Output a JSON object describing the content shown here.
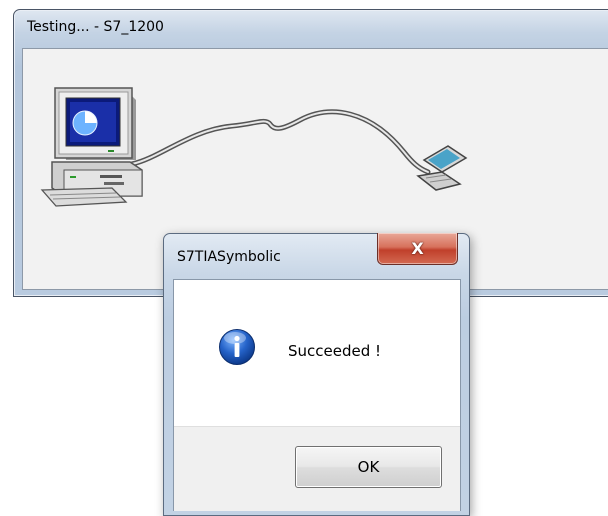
{
  "testing_window": {
    "title": "Testing... - S7_1200"
  },
  "dialog": {
    "title": "S7TIASymbolic",
    "close_glyph": "X",
    "message": "Succeeded !",
    "icon": "info-icon",
    "ok_label": "OK"
  }
}
